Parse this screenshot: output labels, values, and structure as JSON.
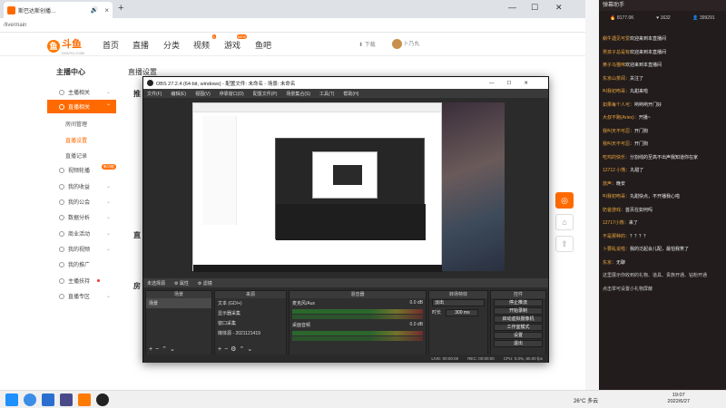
{
  "browser": {
    "tab_title": "斯巴达斯创播…",
    "address": "/live/main",
    "min": "—",
    "restore": "☐",
    "close": "✕",
    "new_tab": "+"
  },
  "site": {
    "logo_text": "斗鱼",
    "logo_sub": "DOUYU.COM",
    "nav": [
      "首页",
      "直播",
      "分类",
      "视频",
      "游戏",
      "鱼吧"
    ],
    "nav_badges": {
      "视频": "1",
      "游戏": "NEW"
    },
    "download": "下载",
    "username": "卜乃丸"
  },
  "sidebar": {
    "title": "主播中心",
    "items": [
      {
        "label": "主播相关"
      },
      {
        "label": "直播相关",
        "active": true
      },
      {
        "label": "我的收益"
      },
      {
        "label": "我的公会"
      },
      {
        "label": "数据分析"
      },
      {
        "label": "商业活动"
      },
      {
        "label": "我的视频"
      },
      {
        "label": "我的推广"
      },
      {
        "label": "主播扶持"
      },
      {
        "label": "直播专区"
      }
    ],
    "sub": [
      "房间管理",
      "直播设置",
      "直播记录"
    ],
    "extra_item": "视频轮播",
    "badge": "新功能"
  },
  "main": {
    "title": "直播设置",
    "sections": [
      "推",
      "直",
      "房"
    ]
  },
  "obs": {
    "title": "OBS 27.2.4 (64-bit, windows) - 配置文件: 未命名 - 场景: 未命名",
    "menu": [
      "文件(F)",
      "编辑(E)",
      "视图(V)",
      "停靠窗口(D)",
      "配置文件(P)",
      "场景集合(S)",
      "工具(T)",
      "帮助(H)"
    ],
    "source_bar": [
      "未选择源",
      "⚙ 属性",
      "⚙ 滤镜"
    ],
    "docks": {
      "scenes": {
        "title": "场景",
        "items": [
          "场景"
        ]
      },
      "sources": {
        "title": "来源",
        "items": [
          "文本 (GDI+)",
          "显示器采集",
          "窗口采集",
          "媒体源 - 2021121419"
        ]
      },
      "mixer": {
        "title": "混音器",
        "items": [
          "麦克风/Aux",
          "桌面音频"
        ],
        "levels": [
          "0.0 dB",
          "0.0 dB"
        ]
      },
      "transitions": {
        "title": "转场特效",
        "fade": "淡出",
        "duration_label": "时长",
        "duration": "300 ms"
      },
      "controls": {
        "title": "控件",
        "buttons": [
          "停止推流",
          "开始录制",
          "启动虚拟摄像机",
          "工作室模式",
          "设置",
          "退出"
        ]
      }
    },
    "status": [
      "LIVE: 00:00:00",
      "REC: 00:00:00",
      "CPU: 0.0%, 60.00 fps"
    ]
  },
  "danmu": {
    "title": "弹幕助手",
    "stats": [
      "8177.0K",
      "1632",
      "399291"
    ],
    "messages": [
      {
        "lv": "",
        "user": "蜗牛遇见可爱",
        "text": "欢迎来到本直播间"
      },
      {
        "lv": "",
        "user": "男孩子总是有",
        "text": "欢迎来到本直播间"
      },
      {
        "lv": "",
        "user": "黄子马猫咪",
        "text": "欢迎来到本直播间"
      },
      {
        "lv": "",
        "user": "东京山茶阅：",
        "text": "关注了"
      },
      {
        "lv": "",
        "user": "叫我初吻哥：",
        "text": "丸甜来啦"
      },
      {
        "lv": "",
        "user": "如果每个人可：",
        "text": "哟哟哟开门好"
      },
      {
        "lv": "",
        "user": "大叔不跑(Aries)：",
        "text": "开播~"
      },
      {
        "lv": "",
        "user": "我叫天不可忍：",
        "text": "开门狗"
      },
      {
        "lv": "",
        "user": "我叫天不可忍：",
        "text": "开门狗"
      },
      {
        "lv": "",
        "user": "吃鸡的快乐：",
        "text": "分割线的至高不出声我知道你在家"
      },
      {
        "lv": "",
        "user": "12712 小熊：",
        "text": "丸甜了"
      },
      {
        "lv": "",
        "user": "放声：",
        "text": "晚安"
      },
      {
        "lv": "",
        "user": "叫我初吻哥：",
        "text": "丸甜快点，不开播我心啦"
      },
      {
        "lv": "",
        "user": "奶爸游戏：",
        "text": "首页在如何吗"
      },
      {
        "lv": "",
        "user": "12717小熊：",
        "text": "来了"
      },
      {
        "lv": "",
        "user": "不是那种的：",
        "text": "？？？？"
      },
      {
        "lv": "",
        "user": "卜要乱说啦：",
        "text": "我的泛起会儿配，最怕我笑了"
      },
      {
        "lv": "",
        "user": "东京：",
        "text": "无聊"
      },
      {
        "lv": "",
        "user": "",
        "text": "这里展示你收到的礼物、道具、贵族开通、钻粉开通"
      },
      {
        "lv": "",
        "user": "",
        "text": "点击举可设置小礼物屏蔽"
      }
    ]
  },
  "taskbar": {
    "weather": "26°C 多云",
    "time": "19:07",
    "date": "2022/6/27"
  },
  "colors": {
    "accent": "#ff6a00",
    "obs_bg": "#2b2b2b",
    "danmu_bg": "#221c1c"
  }
}
